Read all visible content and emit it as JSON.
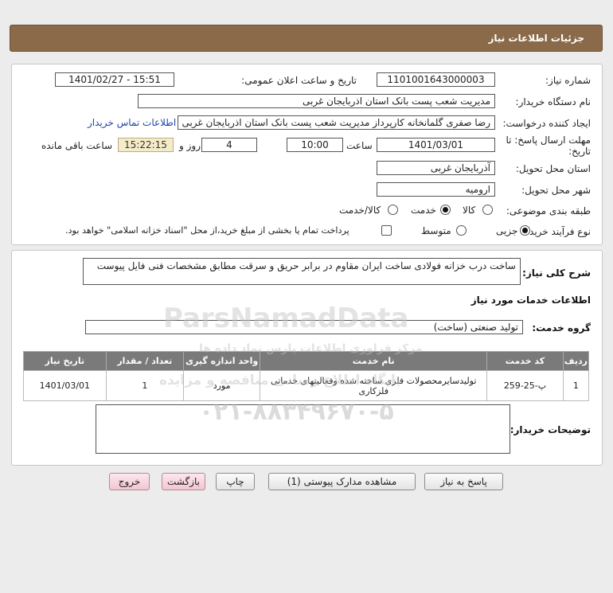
{
  "header": {
    "title": "جزئیات اطلاعات نیاز"
  },
  "form": {
    "need_number": {
      "label": "شماره نیاز:",
      "value": "1101001643000003"
    },
    "announce_datetime": {
      "label": "تاریخ و ساعت اعلان عمومی:",
      "value": "1401/02/27 - 15:51"
    },
    "buyer_org": {
      "label": "نام دستگاه خریدار:",
      "value": "مدیریت شعب پست بانک استان اذربایجان غربی"
    },
    "requester": {
      "label": "ایجاد کننده درخواست:",
      "value": "رضا صفری گلمانخانه کارپرداز مدیریت شعب پست بانک استان اذربایجان غربی",
      "contact_link": "اطلاعات تماس خریدار"
    },
    "deadline": {
      "label_line1": "مهلت ارسال پاسخ: تا",
      "label_line2": "تاریخ:",
      "date": "1401/03/01",
      "time_label": "ساعت",
      "time": "10:00",
      "days": "4",
      "days_label": "روز و",
      "remaining": "15:22:15",
      "remaining_label": "ساعت باقی مانده"
    },
    "delivery_province": {
      "label": "استان محل تحویل:",
      "value": "آذربایجان غربی"
    },
    "delivery_city": {
      "label": "شهر محل تحویل:",
      "value": "ارومیه"
    },
    "category": {
      "label": "طبقه بندی موضوعی:",
      "options": [
        "کالا",
        "خدمت",
        "کالا/خدمت"
      ],
      "selected": "خدمت"
    },
    "purchase_type": {
      "label": "نوع فرآیند خرید :",
      "options": [
        "جزیی",
        "متوسط"
      ],
      "selected": "جزیی",
      "checkbox_text": "پرداخت تمام یا بخشی از مبلغ خرید،از محل \"اسناد خزانه اسلامی\" خواهد بود."
    }
  },
  "description": {
    "label": "شرح کلی نیاز:",
    "value": "ساخت درب خزانه فولادی  ساخت  ایران  مقاوم  در برابر حریق  و  سرقت مطابق مشخصات فنی فایل پیوست"
  },
  "services": {
    "section_title": "اطلاعات خدمات مورد نیاز",
    "group_label": "گروه خدمت:",
    "group_value": "تولید صنعتی (ساخت)",
    "table": {
      "headers": [
        "ردیف",
        "کد خدمت",
        "نام خدمت",
        "واحد اندازه گیری",
        "تعداد / مقدار",
        "تاریخ نیاز"
      ],
      "rows": [
        [
          "1",
          "پ-25-259",
          "تولیدسایرمحصولات فلزی ساخته شده وفعالیتهای خدماتی فلزکاری",
          "مورد",
          "1",
          "1401/03/01"
        ]
      ]
    }
  },
  "buyer_notes": {
    "label": "توضیحات خریدار:",
    "value": ""
  },
  "buttons": {
    "reply": "پاسخ به نیاز",
    "view_docs": "مشاهده مدارک پیوستی (1)",
    "print": "چاپ",
    "back": "بازگشت",
    "exit": "خروج"
  },
  "watermark": {
    "brand": "ParsNamadData",
    "line1": "مرکز فراوری اطلاعات پارس نماد داده ها",
    "line2": "پایگاه اطلاع رسانی مناقصه و مزایده",
    "phone": "۰۲۱-۸۸۳۴۹۶۷۰-۵"
  },
  "colors": {
    "header": "#8a6a48",
    "table_header": "#7a7a7a",
    "link": "#1f46a8",
    "timer_bg": "#f4ecc9"
  }
}
